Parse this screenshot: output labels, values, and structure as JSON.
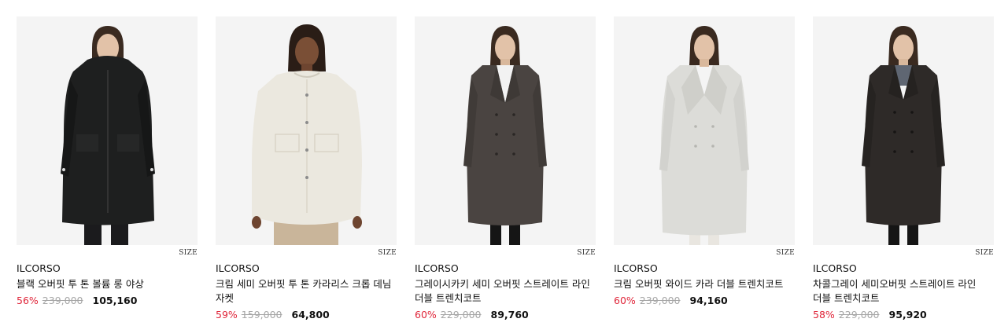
{
  "colors": {
    "discount": "#e0263a",
    "original_price": "#a6a6a6",
    "image_bg": "#f4f4f4"
  },
  "products": [
    {
      "image": "model wearing black oversized hooded long field coat",
      "size_label": "SIZE",
      "brand": "ILCORSO",
      "name": "블랙 오버핏 투 톤 볼륨 롱 야상",
      "discount": "56%",
      "original_price": "239,000",
      "sale_price": "105,160"
    },
    {
      "image": "model wearing cream oversized collarless denim jacket",
      "size_label": "SIZE",
      "brand": "ILCORSO",
      "name": "크림 세미 오버핏 투 톤 카라리스 크롭 데님 자켓",
      "discount": "59%",
      "original_price": "159,000",
      "sale_price": "64,800"
    },
    {
      "image": "model wearing grayish khaki double-breasted long trench coat",
      "size_label": "SIZE",
      "brand": "ILCORSO",
      "name": "그레이시카키 세미 오버핏 스트레이트 라인 더블 트렌치코트",
      "discount": "60%",
      "original_price": "229,000",
      "sale_price": "89,760"
    },
    {
      "image": "model wearing light gray wide collar double trench coat",
      "size_label": "SIZE",
      "brand": "ILCORSO",
      "name": "크림 오버핏 와이드 카라 더블 트렌치코트",
      "discount": "60%",
      "original_price": "239,000",
      "sale_price": "94,160"
    },
    {
      "image": "model wearing charcoal gray double-breasted long trench coat",
      "size_label": "SIZE",
      "brand": "ILCORSO",
      "name": "차콜그레이 세미오버핏 스트레이트 라인 더블 트렌치코트",
      "discount": "58%",
      "original_price": "229,000",
      "sale_price": "95,920"
    }
  ]
}
